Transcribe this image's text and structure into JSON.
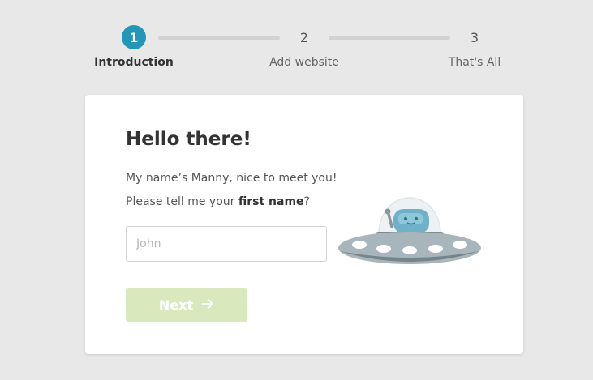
{
  "stepper": {
    "steps": [
      {
        "number": "1",
        "label": "Introduction"
      },
      {
        "number": "2",
        "label": "Add website"
      },
      {
        "number": "3",
        "label": "That's All"
      }
    ]
  },
  "card": {
    "title": "Hello there!",
    "intro_text": "My name’s Manny, nice to meet you!",
    "prompt_prefix": "Please tell me your ",
    "prompt_bold": "first name",
    "prompt_suffix": "?",
    "name_input": {
      "placeholder": "John",
      "value": ""
    },
    "next_button": {
      "label": "Next",
      "icon": "arrow-right-icon"
    },
    "illustration": "ufo-robot-illustration"
  },
  "colors": {
    "background": "#e8e8e8",
    "accent": "#2497b8",
    "step_line": "#d2d2d2",
    "card": "#ffffff",
    "next_button_disabled": "#d9e9bd",
    "title_text": "#333333",
    "body_text": "#555555"
  }
}
